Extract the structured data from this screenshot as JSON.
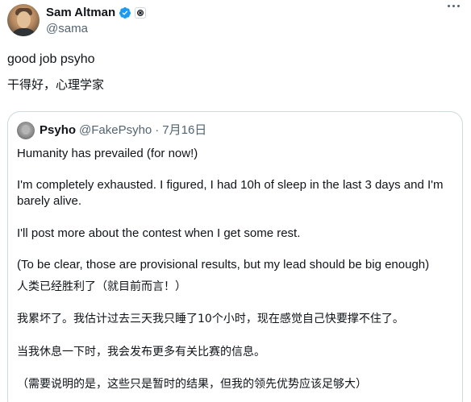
{
  "author": {
    "display_name": "Sam Altman",
    "handle": "@sama"
  },
  "tweet": {
    "lines": [
      "good job psyho",
      "干得好，心理学家"
    ]
  },
  "quoted_tweet": {
    "display_name": "Psyho",
    "handle": "@FakePsyho",
    "separator": "·",
    "date": "7月16日",
    "paragraphs": [
      "Humanity has prevailed (for now!)",
      "I'm completely exhausted. I figured, I had 10h of sleep in the last 3 days and I'm",
      "barely alive.",
      "I'll post more about the contest when I get some rest.",
      "(To be clear, those are provisional results, but my lead should be big enough)",
      "人类已经胜利了（就目前而言！）",
      "我累坏了。我估计过去三天我只睡了10个小时，现在感觉自己快要撑不住了。",
      "当我休息一下时，我会发布更多有关比赛的信息。",
      "（需要说明的是，这些只是暂时的结果，但我的领先优势应该足够大）"
    ]
  },
  "icons": {
    "verified": "verified-badge-icon",
    "affiliation": "affiliation-badge-icon",
    "more": "more-options-icon"
  },
  "colors": {
    "verified_blue": "#1d9bf0",
    "secondary_text": "#536471",
    "border": "#cfd9de"
  }
}
